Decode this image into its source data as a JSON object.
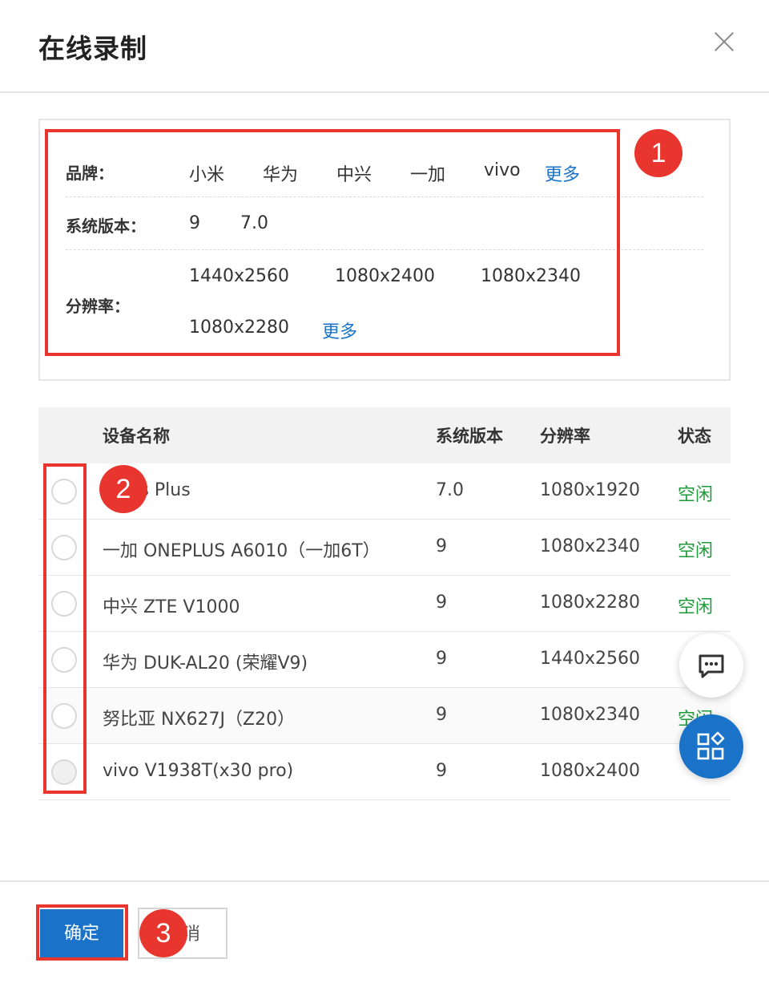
{
  "dialog": {
    "title": "在线录制"
  },
  "filters": {
    "brand": {
      "label": "品牌：",
      "options": [
        "小米",
        "华为",
        "中兴",
        "一加",
        "vivo"
      ],
      "more": "更多"
    },
    "os": {
      "label": "系统版本：",
      "options": [
        "9",
        "7.0"
      ]
    },
    "resolution": {
      "label": "分辨率：",
      "options": [
        "1440x2560",
        "1080x2400",
        "1080x2340",
        "1080x2280"
      ],
      "more": "更多"
    }
  },
  "table": {
    "headers": {
      "name": "设备名称",
      "os": "系统版本",
      "resolution": "分辨率",
      "status": "状态"
    },
    "rows": [
      {
        "name": "MI 5s Plus",
        "os": "7.0",
        "resolution": "1080x1920",
        "status": "空闲"
      },
      {
        "name": "一加 ONEPLUS A6010（一加6T）",
        "os": "9",
        "resolution": "1080x2340",
        "status": "空闲"
      },
      {
        "name": "中兴 ZTE V1000",
        "os": "9",
        "resolution": "1080x2280",
        "status": "空闲"
      },
      {
        "name": "华为 DUK-AL20 (荣耀V9)",
        "os": "9",
        "resolution": "1440x2560",
        "status": ""
      },
      {
        "name": "努比亚 NX627J（Z20）",
        "os": "9",
        "resolution": "1080x2340",
        "status": "空闲"
      },
      {
        "name": "vivo V1938T(x30 pro)",
        "os": "9",
        "resolution": "1080x2400",
        "status": ""
      }
    ]
  },
  "footer": {
    "ok_label": "确定",
    "cancel_label": "消"
  },
  "annotations": [
    "1",
    "2",
    "3"
  ],
  "icons": {
    "close": "close-icon",
    "chat": "chat-icon",
    "apps": "apps-icon"
  },
  "colors": {
    "primary": "#1a73c8",
    "annotation": "#e8352d",
    "status_idle": "#1f9a3a"
  }
}
